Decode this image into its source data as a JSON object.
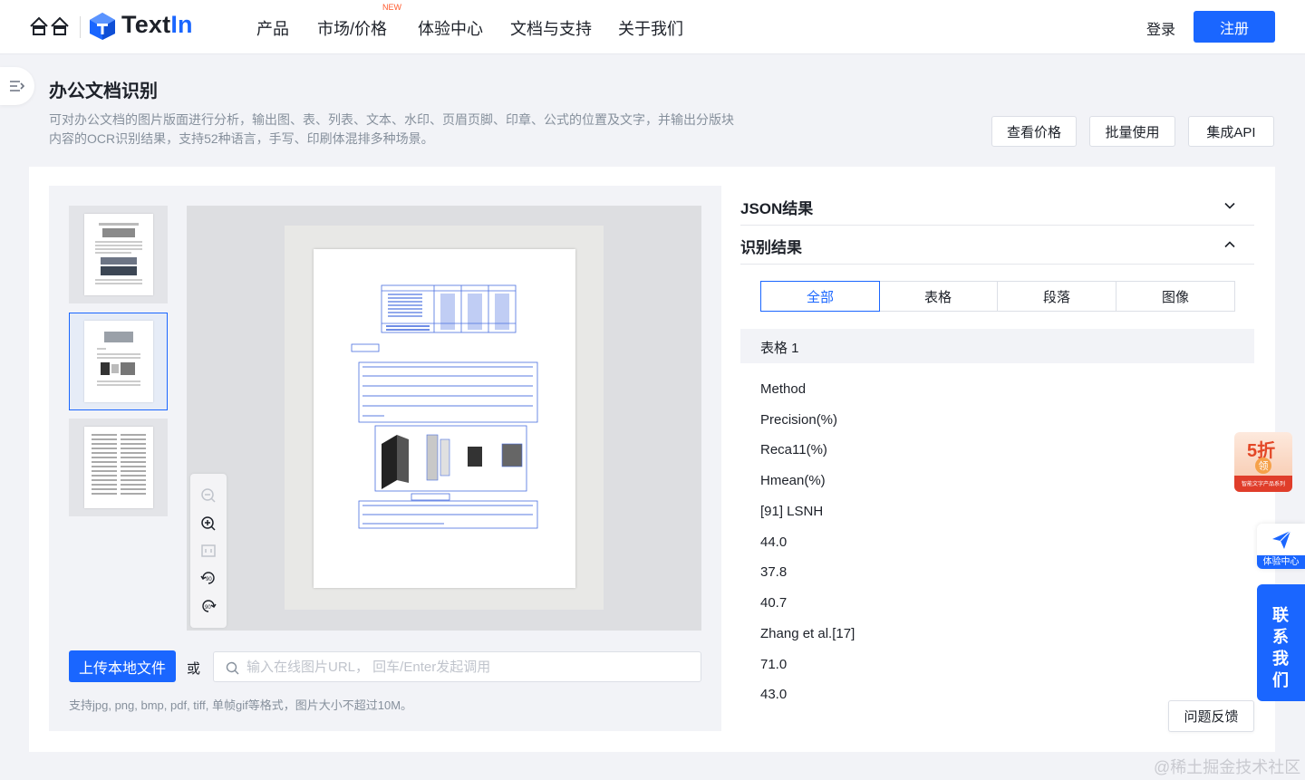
{
  "nav": {
    "brand": {
      "prefix": "Text",
      "suffix": "In"
    },
    "items": [
      "产品",
      "市场/价格",
      "体验中心",
      "文档与支持",
      "关于我们"
    ],
    "new_badge": "NEW",
    "login": "登录",
    "register": "注册"
  },
  "header": {
    "title": "办公文档识别",
    "description": "可对办公文档的图片版面进行分析，输出图、表、列表、文本、水印、页眉页脚、印章、公式的位置及文字，并输出分版块内容的OCR识别结果，支持52种语言，手写、印刷体混排多种场景。",
    "buttons": [
      "查看价格",
      "批量使用",
      "集成API"
    ]
  },
  "upload": {
    "button": "上传本地文件",
    "or": "或",
    "url_placeholder": "输入在线图片URL， 回车/Enter发起调用",
    "note": "支持jpg, png, bmp, pdf, tiff, 单帧gif等格式，图片大小不超过10M。"
  },
  "results": {
    "json_title": "JSON结果",
    "recog_title": "识别结果",
    "tabs": [
      "全部",
      "表格",
      "段落",
      "图像"
    ],
    "active_tab": "全部",
    "section": "表格 1",
    "items": [
      "Method",
      "Precision(%)",
      "Reca11(%)",
      "Hmean(%)",
      "[91] LSNH",
      "44.0",
      "37.8",
      "40.7",
      "Zhang et al.[17]",
      "71.0",
      "43.0"
    ]
  },
  "widgets": {
    "promo_big": "5折",
    "promo_coin": "领",
    "promo_small": "智能文字产品系列",
    "experience": "体验中心",
    "contact": [
      "联",
      "系",
      "我",
      "们"
    ],
    "feedback": "问题反馈"
  },
  "watermark": "@稀土掘金技术社区",
  "colors": {
    "primary": "#1a66ff",
    "background": "#f2f3f7",
    "promo": "#e34726"
  },
  "icons": [
    "hehe-logo-icon",
    "textin-cube-icon",
    "menu-expand-icon",
    "zoom-out-icon",
    "zoom-in-icon",
    "fit-page-icon",
    "rotate-left-icon",
    "rotate-right-icon",
    "search-icon",
    "chevron-down-icon",
    "chevron-up-icon",
    "paper-plane-icon"
  ]
}
